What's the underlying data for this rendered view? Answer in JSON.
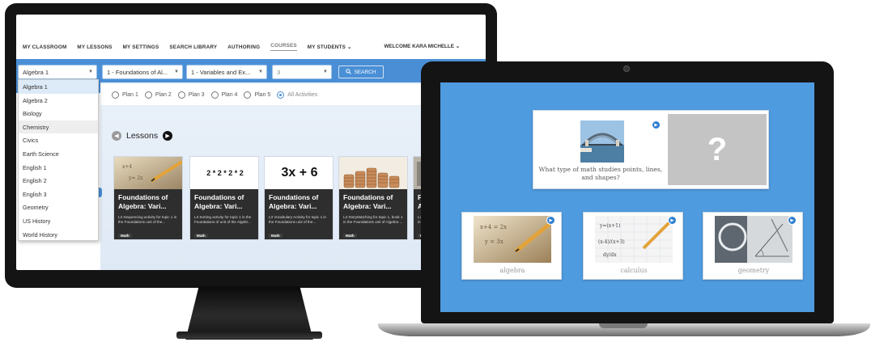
{
  "monitor": {
    "nav": {
      "items": [
        "MY CLASSROOM",
        "MY LESSONS",
        "MY SETTINGS",
        "SEARCH LIBRARY",
        "AUTHORING",
        "COURSES",
        "MY STUDENTS"
      ],
      "active": "COURSES",
      "welcome": "WELCOME KARA MICHELLE"
    },
    "filters": {
      "course": "Algebra 1",
      "unit": "1 - Foundations of Al...",
      "topic": "1 - Variables and Ex...",
      "level": "3",
      "search_label": "SEARCH"
    },
    "course_dropdown": {
      "options": [
        "Algebra 1",
        "Algebra 2",
        "Biology",
        "Chemistry",
        "Civics",
        "Earth Science",
        "English 1",
        "English 2",
        "English 3",
        "Geometry",
        "US History",
        "World History"
      ],
      "selected": "Algebra 1",
      "hovered": "Chemistry"
    },
    "plans": {
      "options": [
        "Plan 1",
        "Plan 2",
        "Plan 3",
        "Plan 4",
        "Plan 5",
        "All Activities"
      ],
      "selected": "All Activities"
    },
    "lessons": {
      "heading": "Lessons",
      "cards": [
        {
          "title": "Foundations of Algebra: Vari...",
          "desc": "L3 Sequencing activity for topic 1 in the Foundations unit of the...",
          "badge": "Math",
          "thumb_text": ""
        },
        {
          "title": "Foundations of Algebra: Vari...",
          "desc": "L3 Sorting activity for topic 1 in the Foundations of unit of the Algebr...",
          "badge": "Math",
          "thumb_text": "2 * 2 * 2 * 2"
        },
        {
          "title": "Foundations of Algebra: Vari...",
          "desc": "L3 Vocabulary Activity for topic 1 in the Foundations unit of the...",
          "badge": "Math",
          "thumb_text": "3x + 6"
        },
        {
          "title": "Foundations of Algebra: Vari...",
          "desc": "L3 StoryMatching for topic 1, book 1 in the Foundations unit of Algebra ...",
          "badge": "Math",
          "thumb_text": ""
        },
        {
          "title": "Fo Alg",
          "desc": "L3 for 1 in ...",
          "badge": "Math",
          "thumb_text": ""
        }
      ]
    }
  },
  "laptop": {
    "question": {
      "text": "What type of math studies points, lines, and shapes?",
      "mystery_symbol": "?"
    },
    "answers": [
      {
        "label": "algebra"
      },
      {
        "label": "calculus"
      },
      {
        "label": "geometry"
      }
    ]
  },
  "colors": {
    "accent_blue": "#4a8fd6",
    "laptop_bg": "#4f9be0",
    "lesson_overlay": "#232323",
    "mystery_gray": "#c4c4c4"
  },
  "icons": [
    "caret-down-icon",
    "search-icon",
    "prev-arrow-icon",
    "next-arrow-icon",
    "play-icon",
    "question-mark-icon"
  ]
}
